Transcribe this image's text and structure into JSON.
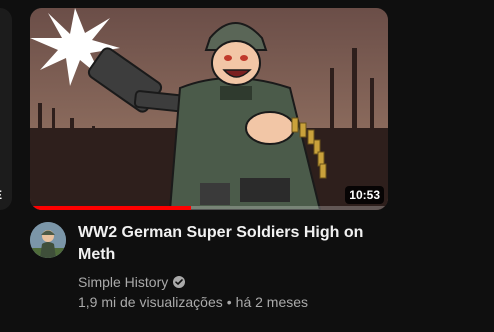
{
  "previous_card": {
    "badge": "E"
  },
  "video": {
    "duration": "10:53",
    "progress_fraction": 0.45,
    "title": "WW2 German Super Soldiers High on Meth",
    "channel": "Simple History",
    "views": "1,9 mi de visualizações",
    "separator": "•",
    "age": "há 2 meses"
  },
  "colors": {
    "progress": "#ff0000",
    "background": "#0f0f0f",
    "secondary_text": "#aaaaaa"
  },
  "icons": {
    "verified": "check-circle-icon"
  }
}
